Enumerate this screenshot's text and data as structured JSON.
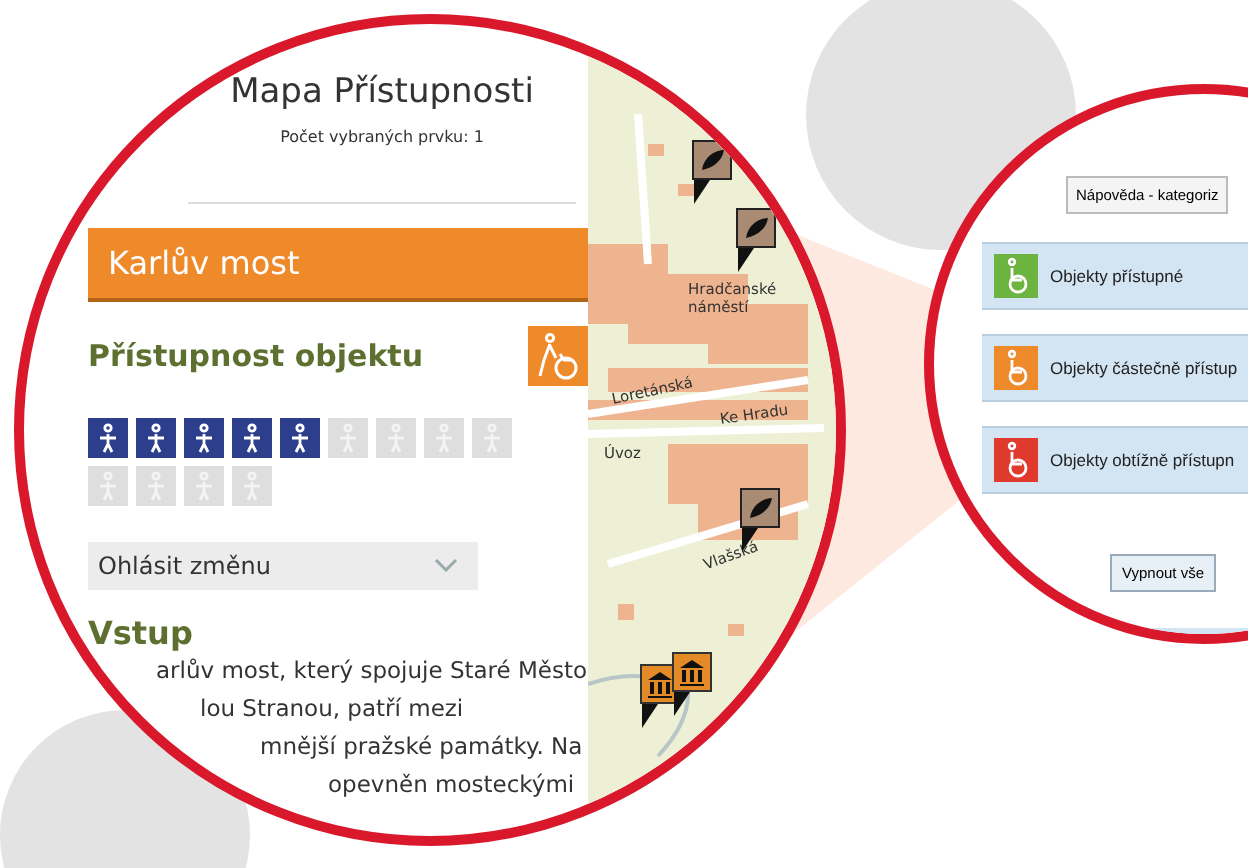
{
  "left_panel": {
    "title": "Mapa Přístupnosti",
    "selected_count": "Počet vybraných prvku: 1",
    "place": {
      "name": "Karlův most",
      "section_title": "Přístupnost objektu",
      "amenities": [
        {
          "on": true
        },
        {
          "on": true
        },
        {
          "on": true
        },
        {
          "on": true
        },
        {
          "on": true
        },
        {
          "on": false
        },
        {
          "on": false
        },
        {
          "on": false
        },
        {
          "on": false
        },
        {
          "on": false
        },
        {
          "on": false
        },
        {
          "on": false
        },
        {
          "on": false
        }
      ],
      "report_dropdown": "Ohlásit změnu",
      "entry_heading": "Vstup",
      "description_lines": [
        "arlův most, který spojuje Staré Město",
        "lou Stranou, patří mezi",
        "mnější pražské památky. Na",
        "opevněn mosteckými"
      ]
    }
  },
  "map": {
    "labels": [
      "Hradčanské náměstí",
      "Loretánská",
      "Ke Hradu",
      "Úvoz",
      "Vlašská"
    ]
  },
  "legend": {
    "help_button": "Nápověda - kategoriz",
    "categories": [
      {
        "label": "Objekty přístupné",
        "color": "#6cb33f"
      },
      {
        "label": "Objekty částečně přístup",
        "color": "#ef8a2b"
      },
      {
        "label": "Objekty obtížně přístupn",
        "color": "#e03a2f"
      }
    ],
    "buttons": [
      "Vypnout vše"
    ]
  }
}
